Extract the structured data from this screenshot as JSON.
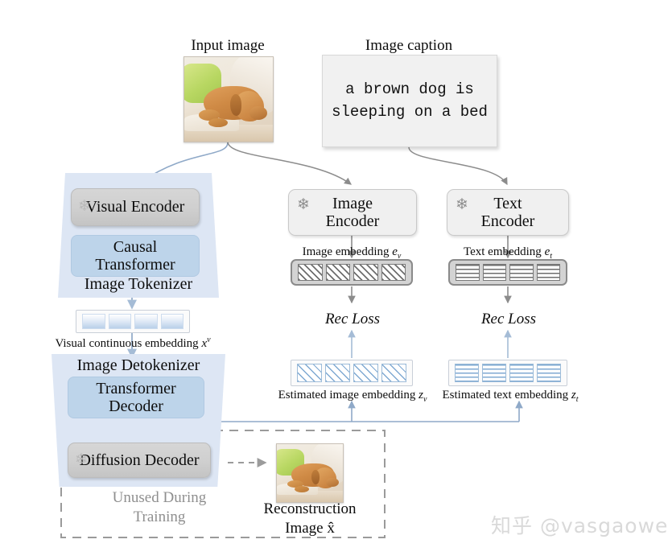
{
  "diagram": {
    "title_input_image": "Input image",
    "title_image_caption": "Image caption",
    "caption_text": "a brown dog is\nsleeping on a bed",
    "tokenizer": {
      "visual_encoder": "Visual Encoder",
      "causal_transformer": "Causal\nTransformer",
      "name": "Image Tokenizer",
      "frozen_icon": "snowflake-icon"
    },
    "detokenizer": {
      "name": "Image Detokenizer",
      "transformer_decoder": "Transformer\nDecoder",
      "diffusion_decoder": "Diffusion Decoder",
      "frozen_icon": "snowflake-icon"
    },
    "visual_embedding_label": "Visual continuous embedding",
    "visual_embedding_symbol": "x",
    "visual_embedding_symbol_sup": "v",
    "image_encoder": "Image\nEncoder",
    "text_encoder": "Text\nEncoder",
    "image_embedding_label": "Image embedding",
    "image_embedding_symbol": "e",
    "image_embedding_symbol_sub": "v",
    "text_embedding_label": "Text embedding",
    "text_embedding_symbol": "e",
    "text_embedding_symbol_sub": "t",
    "rec_loss_left": "Rec Loss",
    "rec_loss_right": "Rec Loss",
    "est_image_embedding_label": "Estimated image embedding",
    "est_image_embedding_symbol": "z",
    "est_image_embedding_symbol_sub": "v",
    "est_text_embedding_label": "Estimated text embedding",
    "est_text_embedding_symbol": "z",
    "est_text_embedding_symbol_sub": "t",
    "unused_note": "Unused During\nTraining",
    "reconstruction_label": "Reconstruction\nImage x̂",
    "watermark": "知乎 @vasgaowei",
    "cell_count": 4,
    "colors": {
      "trapezoid_fill": "#dde6f4",
      "blue_module": "#bdd4ea",
      "gray_module": "#cfcfcf",
      "blue_arrow": "#8fa9c8",
      "gray_arrow": "#8c8c8c",
      "dashed_border": "#9a9a9a",
      "watermark": "#d9d9d9"
    }
  }
}
